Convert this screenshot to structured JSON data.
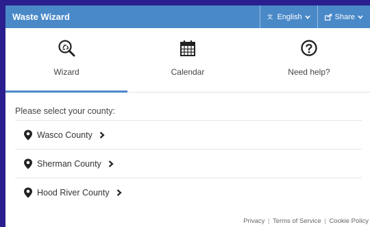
{
  "header": {
    "title": "Waste Wizard",
    "language_label": "English",
    "share_label": "Share"
  },
  "tabs": [
    {
      "label": "Wizard",
      "icon": "recycle-search-icon",
      "active": true
    },
    {
      "label": "Calendar",
      "icon": "calendar-icon",
      "active": false
    },
    {
      "label": "Need help?",
      "icon": "question-circle-icon",
      "active": false
    }
  ],
  "main": {
    "prompt": "Please select your county:",
    "counties": [
      {
        "label": "Wasco County"
      },
      {
        "label": "Sherman County"
      },
      {
        "label": "Hood River County"
      }
    ]
  },
  "footer": {
    "privacy": "Privacy",
    "terms": "Terms of Service",
    "cookie": "Cookie Policy",
    "separator": "|"
  },
  "colors": {
    "brand": "#4a89c8",
    "page_background": "#2b1f8f"
  }
}
